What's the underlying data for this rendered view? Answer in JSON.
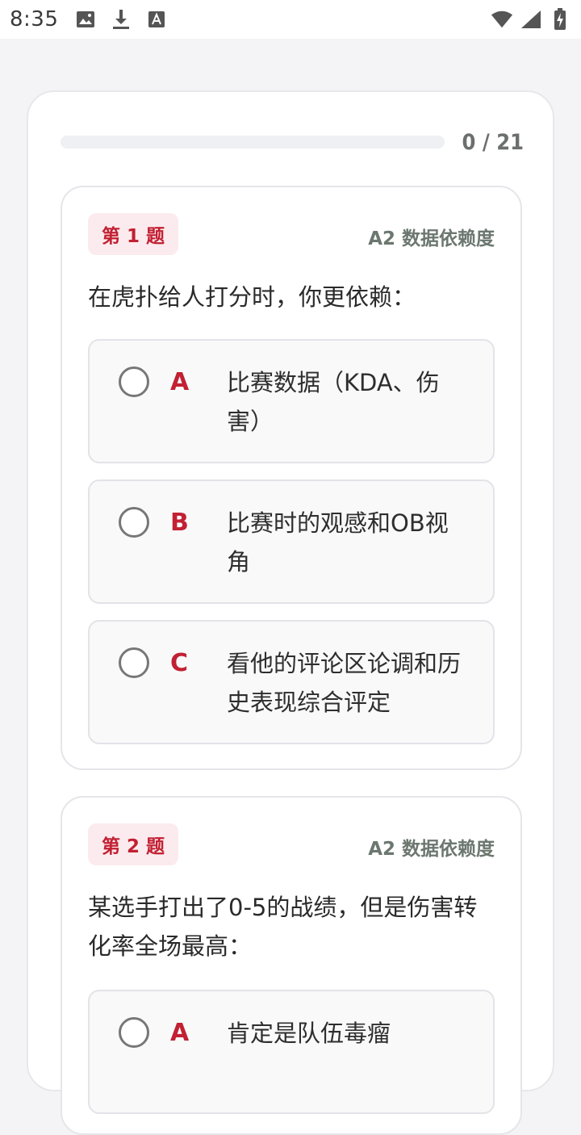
{
  "status_bar": {
    "time": "8:35",
    "icons": [
      "image-icon",
      "download-icon",
      "font-icon",
      "wifi-icon",
      "signal-icon",
      "battery-charging-icon"
    ]
  },
  "progress": {
    "text": "0 / 21",
    "fraction": 0
  },
  "questions": [
    {
      "badge": "第 1 题",
      "category": "A2 数据依赖度",
      "text": "在虎扑给人打分时，你更依赖：",
      "options": [
        {
          "letter": "A",
          "text": "比赛数据（KDA、伤害）"
        },
        {
          "letter": "B",
          "text": "比赛时的观感和OB视角"
        },
        {
          "letter": "C",
          "text": "看他的评论区论调和历史表现综合评定"
        }
      ]
    },
    {
      "badge": "第 2 题",
      "category": "A2 数据依赖度",
      "text": "某选手打出了0-5的战绩，但是伤害转化率全场最高：",
      "options": [
        {
          "letter": "A",
          "text": "肯定是队伍毒瘤"
        }
      ]
    }
  ],
  "colors": {
    "accent": "#c22033",
    "badge_bg": "#fcebee",
    "category": "#6b776f",
    "page_bg": "#f4f4f6"
  }
}
